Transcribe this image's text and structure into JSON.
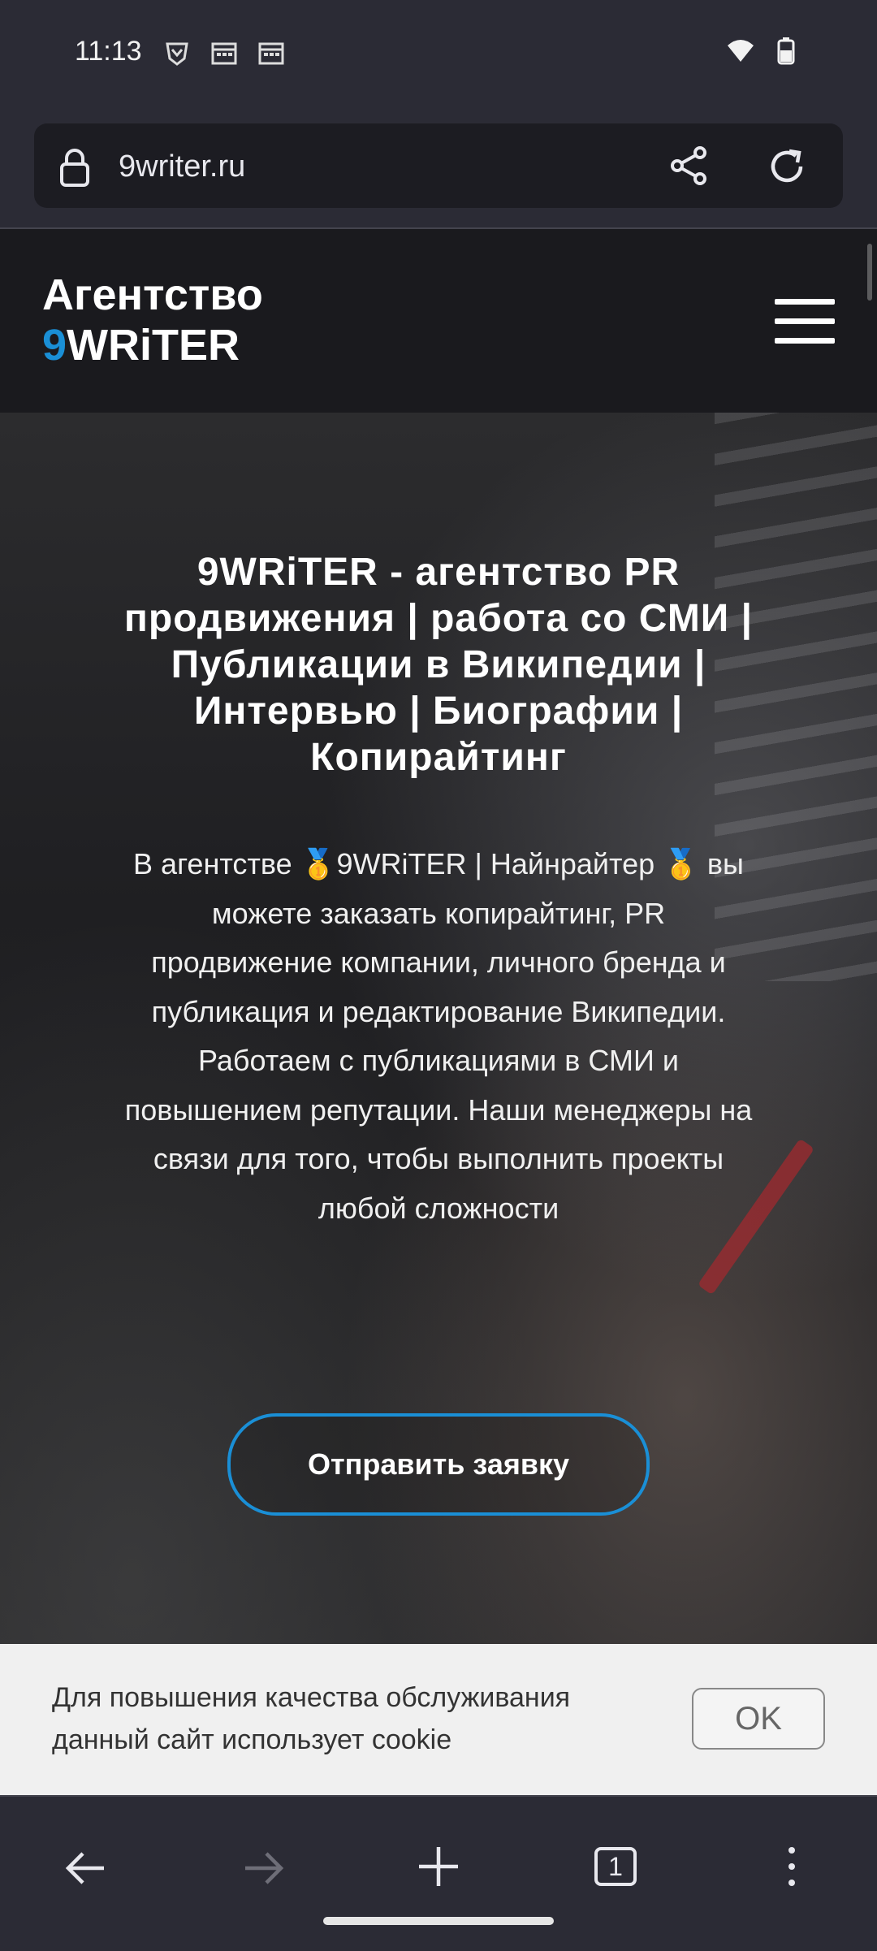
{
  "status": {
    "time": "11:13",
    "left_icons": [
      "brave-shield-icon",
      "calendar-icon",
      "calendar-icon"
    ],
    "right_icons": [
      "wifi-icon",
      "battery-charging-icon"
    ]
  },
  "browser": {
    "url": "9writer.ru",
    "tabs_count": "1"
  },
  "site": {
    "logo_line1": "Агентство",
    "logo_nine": "9",
    "logo_rest": "WRiTER",
    "hero_title": "9WRiTER - агентство PR продвижения | работа со СМИ | Публикации в Википедии | Интервью | Биографии | Копирайтинг",
    "hero_text": "В агентстве 🥇9WRiTER | Найнрайтер 🥇 вы можете заказать копирайтинг, PR продвижение компании, личного бренда и публикация и редактирование Википедии. Работаем с публикациями в СМИ и повышением репутации. Наши менеджеры на связи для того, чтобы выполнить проекты любой сложности",
    "cta_label": "Отправить заявку"
  },
  "cookie": {
    "text": "Для повышения качества обслуживания данный сайт использует cookie",
    "ok_label": "OK"
  },
  "colors": {
    "accent": "#1a8fd6",
    "chrome": "#2b2b35"
  }
}
